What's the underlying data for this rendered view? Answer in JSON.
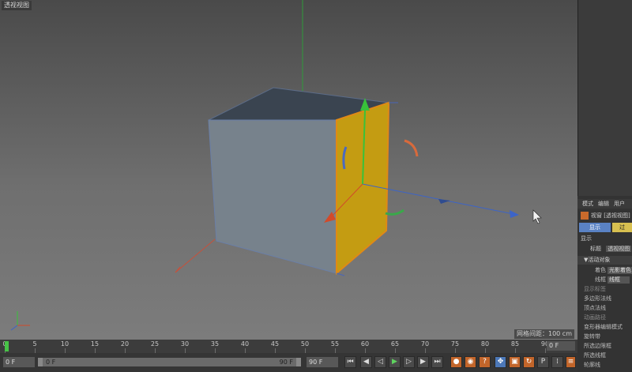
{
  "viewport": {
    "title": "透视视图",
    "grid_spacing": "网格间距：100 cm"
  },
  "attributes": {
    "menu": [
      "模式",
      "编辑",
      "用户"
    ],
    "object_title": "视窗 [透视视图]",
    "tabs": [
      "显示",
      "过"
    ],
    "section_display": "显示",
    "subtabs": [
      "标题",
      "透视视图"
    ],
    "group_active": "▼活动对象",
    "rows": [
      {
        "label": "着色",
        "value": "光影着色"
      },
      {
        "label": "线框",
        "value": "线框"
      },
      {
        "label": "显示标签",
        "value": ""
      },
      {
        "label": "多边形法线",
        "value": ""
      },
      {
        "label": "顶点法线",
        "value": ""
      },
      {
        "label": "动画路径",
        "value": ""
      },
      {
        "label": "变形器编辑模式",
        "value": ""
      },
      {
        "label": "旋转带",
        "value": ""
      },
      {
        "label": "所选边限框",
        "value": ""
      },
      {
        "label": "所选线框",
        "value": ""
      },
      {
        "label": "轮廓线",
        "value": ""
      }
    ]
  },
  "timeline": {
    "ticks": [
      "0",
      "5",
      "10",
      "15",
      "20",
      "25",
      "30",
      "35",
      "40",
      "45",
      "50",
      "55",
      "60",
      "65",
      "70",
      "75",
      "80",
      "85",
      "90"
    ],
    "current_frame": "0 F"
  },
  "transport": {
    "start_frame": "0 F",
    "range_min": "0 F",
    "range_max": "90 F",
    "end_frame": "90 F",
    "buttons": [
      {
        "name": "go-to-start-button",
        "glyph": "⏮"
      },
      {
        "name": "previous-key-button",
        "glyph": "◀"
      },
      {
        "name": "step-back-button",
        "glyph": "◁"
      },
      {
        "name": "play-button",
        "glyph": "▶"
      },
      {
        "name": "step-forward-button",
        "glyph": "▷"
      },
      {
        "name": "next-key-button",
        "glyph": "▶"
      },
      {
        "name": "go-to-end-button",
        "glyph": "⏭"
      }
    ]
  },
  "colors": {
    "cube_front": "#77828c",
    "cube_top": "#3a4450",
    "cube_side_selected": "#c49c12",
    "selection_outline": "#e08a16",
    "axis_x": "#3c64c8",
    "axis_y": "#38c23a",
    "axis_z": "#d24a2a",
    "playhead": "#47c247",
    "record_orange": "#c2652a"
  }
}
